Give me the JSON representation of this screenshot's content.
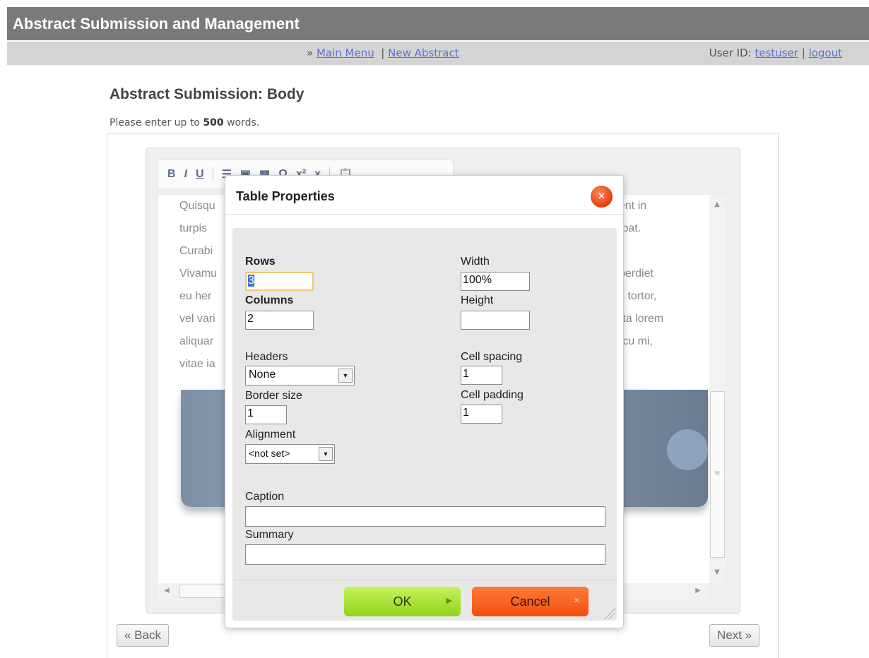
{
  "header": {
    "app_title": "Abstract Submission and Management",
    "nav_prefix": "»",
    "main_menu": "Main Menu",
    "separator": "|",
    "new_abstract": "New Abstract",
    "user_id_label": "User ID:",
    "user_id": "testuser",
    "logout": "logout"
  },
  "page": {
    "title": "Abstract Submission: Body",
    "instruction_pre": "Please enter up to",
    "word_limit": "500",
    "instruction_post": "words."
  },
  "editor": {
    "toolbar": [
      {
        "label": "B",
        "icon": "bold-icon"
      },
      {
        "label": "I",
        "icon": "italic-icon"
      },
      {
        "label": "U",
        "icon": "underline-icon"
      },
      {
        "label": "☰",
        "icon": "bullet-list-icon"
      },
      {
        "label": "▣",
        "icon": "image-icon"
      },
      {
        "label": "▦",
        "icon": "table-icon"
      },
      {
        "label": "Ω",
        "icon": "special-char-icon"
      },
      {
        "label": "x²",
        "icon": "superscript-icon"
      },
      {
        "label": "x",
        "icon": "subscript-icon"
      },
      {
        "label": "📋",
        "icon": "paste-icon"
      }
    ],
    "content_lines_left": [
      "Quisqu",
      "turpis",
      "Curabi",
      "Vivamu",
      "eu her",
      "vel vari",
      "aliquar",
      "vitae ia"
    ],
    "content_lines_right": [
      "ent in",
      "tpat.",
      "",
      "perdiet",
      "s tortor,",
      "rta lorem",
      "rcu mi,"
    ]
  },
  "dialog": {
    "title": "Table Properties",
    "rows_label": "Rows",
    "rows_value": "3",
    "columns_label": "Columns",
    "columns_value": "2",
    "headers_label": "Headers",
    "headers_value": "None",
    "border_label": "Border size",
    "border_value": "1",
    "alignment_label": "Alignment",
    "alignment_value": "<not set>",
    "width_label": "Width",
    "width_value": "100%",
    "height_label": "Height",
    "height_value": "",
    "cell_spacing_label": "Cell spacing",
    "cell_spacing_value": "1",
    "cell_padding_label": "Cell padding",
    "cell_padding_value": "1",
    "caption_label": "Caption",
    "caption_value": "",
    "summary_label": "Summary",
    "summary_value": "",
    "ok_label": "OK",
    "cancel_label": "Cancel"
  },
  "footer": {
    "back_label": "« Back",
    "next_label": "Next »"
  },
  "colors": {
    "title_bar": "#7a7a7a",
    "nav_bar": "#d4d4d4",
    "link": "#5a73d2",
    "ok_button": "#9ad82a",
    "cancel_button": "#f25a1a"
  }
}
